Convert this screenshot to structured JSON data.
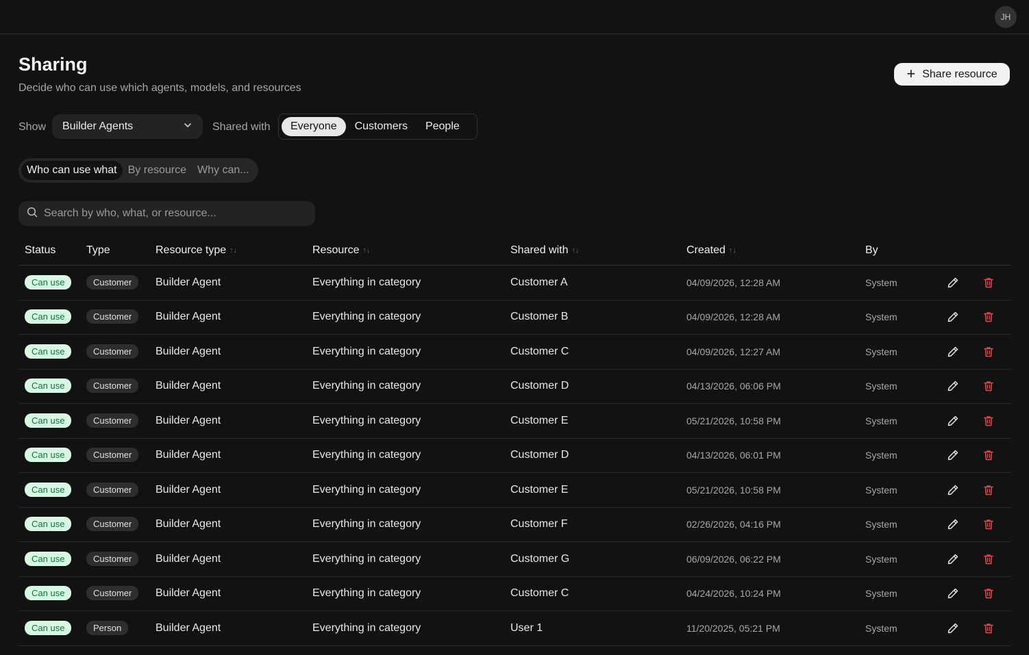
{
  "header": {
    "avatar_initials": "JH"
  },
  "page": {
    "title": "Sharing",
    "subtitle": "Decide who can use which agents, models, and resources",
    "share_button": "Share resource"
  },
  "filters": {
    "show_label": "Show",
    "show_value": "Builder Agents",
    "shared_with_label": "Shared with",
    "shared_with_options": [
      "Everyone",
      "Customers",
      "People"
    ],
    "shared_with_selected": "Everyone"
  },
  "views": {
    "tabs": [
      "Who can use what",
      "By resource",
      "Why can..."
    ],
    "selected": "Who can use what"
  },
  "search": {
    "placeholder": "Search by who, what, or resource..."
  },
  "table": {
    "columns": [
      "Status",
      "Type",
      "Resource type",
      "Resource",
      "Shared with",
      "Created",
      "By"
    ],
    "sortable": [
      "Resource type",
      "Resource",
      "Shared with",
      "Created"
    ],
    "rows": [
      {
        "status": "Can use",
        "type": "Customer",
        "resource_type": "Builder Agent",
        "resource": "Everything in category",
        "shared_with": "Customer A",
        "created": "04/09/2026, 12:28 AM",
        "by": "System"
      },
      {
        "status": "Can use",
        "type": "Customer",
        "resource_type": "Builder Agent",
        "resource": "Everything in category",
        "shared_with": "Customer B",
        "created": "04/09/2026, 12:28 AM",
        "by": "System"
      },
      {
        "status": "Can use",
        "type": "Customer",
        "resource_type": "Builder Agent",
        "resource": "Everything in category",
        "shared_with": "Customer C",
        "created": "04/09/2026, 12:27 AM",
        "by": "System"
      },
      {
        "status": "Can use",
        "type": "Customer",
        "resource_type": "Builder Agent",
        "resource": "Everything in category",
        "shared_with": "Customer D",
        "created": "04/13/2026, 06:06 PM",
        "by": "System"
      },
      {
        "status": "Can use",
        "type": "Customer",
        "resource_type": "Builder Agent",
        "resource": "Everything in category",
        "shared_with": "Customer E",
        "created": "05/21/2026, 10:58 PM",
        "by": "System"
      },
      {
        "status": "Can use",
        "type": "Customer",
        "resource_type": "Builder Agent",
        "resource": "Everything in category",
        "shared_with": "Customer D",
        "created": "04/13/2026, 06:01 PM",
        "by": "System"
      },
      {
        "status": "Can use",
        "type": "Customer",
        "resource_type": "Builder Agent",
        "resource": "Everything in category",
        "shared_with": "Customer E",
        "created": "05/21/2026, 10:58 PM",
        "by": "System"
      },
      {
        "status": "Can use",
        "type": "Customer",
        "resource_type": "Builder Agent",
        "resource": "Everything in category",
        "shared_with": "Customer F",
        "created": "02/26/2026, 04:16 PM",
        "by": "System"
      },
      {
        "status": "Can use",
        "type": "Customer",
        "resource_type": "Builder Agent",
        "resource": "Everything in category",
        "shared_with": "Customer G",
        "created": "06/09/2026, 06:22 PM",
        "by": "System"
      },
      {
        "status": "Can use",
        "type": "Customer",
        "resource_type": "Builder Agent",
        "resource": "Everything in category",
        "shared_with": "Customer C",
        "created": "04/24/2026, 10:24 PM",
        "by": "System"
      },
      {
        "status": "Can use",
        "type": "Person",
        "resource_type": "Builder Agent",
        "resource": "Everything in category",
        "shared_with": "User 1",
        "created": "11/20/2025, 05:21 PM",
        "by": "System"
      }
    ]
  },
  "colors": {
    "background": "#121212",
    "status_badge_bg": "#d7f8e3",
    "status_badge_text": "#12713e",
    "delete_icon": "#e5484d"
  },
  "icons": {
    "edit": "pencil-icon",
    "delete": "trash-icon",
    "search": "search-icon",
    "dropdown": "chevron-down-icon",
    "add": "plus-icon"
  }
}
